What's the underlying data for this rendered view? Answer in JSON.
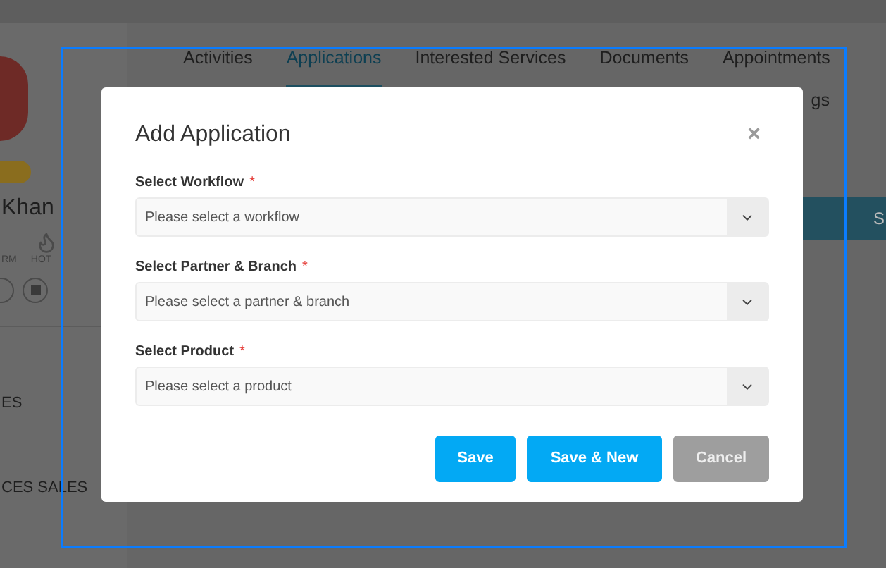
{
  "background": {
    "profile": {
      "name": "Khan",
      "tags": [
        "RM",
        "HOT"
      ],
      "menu": [
        "ES",
        "CES SALES"
      ]
    },
    "tabs": [
      {
        "label": "Activities",
        "selected": false
      },
      {
        "label": "Applications",
        "selected": true
      },
      {
        "label": "Interested Services",
        "selected": false
      },
      {
        "label": "Documents",
        "selected": false
      },
      {
        "label": "Appointments",
        "selected": false
      }
    ],
    "tab_overflow": "gs",
    "bar_text": "S"
  },
  "dialog": {
    "title": "Add Application",
    "close": "×",
    "fields": [
      {
        "label": "Select Workflow",
        "marker": "*",
        "placeholder": "Please select a workflow"
      },
      {
        "label": "Select Partner & Branch",
        "marker": "*",
        "placeholder": "Please select a partner & branch"
      },
      {
        "label": "Select Product",
        "marker": "*",
        "placeholder": "Please select a product"
      }
    ],
    "buttons": [
      {
        "label": "Save",
        "kind": "primary"
      },
      {
        "label": "Save & New",
        "kind": "primary"
      },
      {
        "label": "Cancel",
        "kind": "secondary"
      }
    ]
  }
}
